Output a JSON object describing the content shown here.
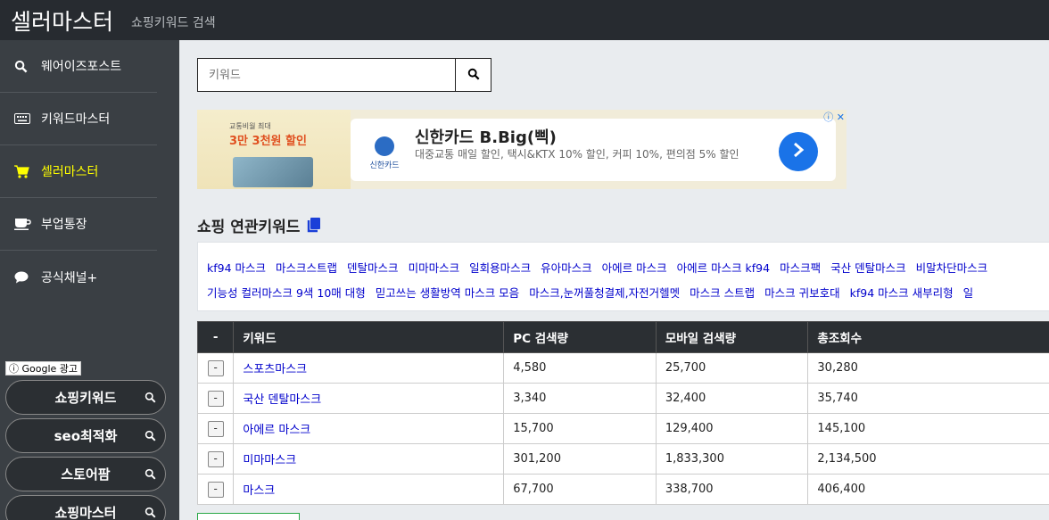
{
  "header": {
    "brand": "셀러마스터",
    "subtitle": "쇼핑키워드 검색"
  },
  "sidebar": {
    "items": [
      {
        "label": "웨어이즈포스트",
        "icon": "search-icon",
        "active": false
      },
      {
        "label": "키워드마스터",
        "icon": "keyboard-icon",
        "active": false
      },
      {
        "label": "셀러마스터",
        "icon": "shopping-cart-icon",
        "active": true
      },
      {
        "label": "부업통장",
        "icon": "coffee-cup-icon",
        "active": false
      },
      {
        "label": "공식채널+",
        "icon": "chat-bubble-icon",
        "active": false
      }
    ],
    "ad_label": "Google 광고",
    "ad_pills": [
      "쇼핑키워드",
      "seo최적화",
      "스토어팜",
      "쇼핑마스터"
    ]
  },
  "search": {
    "placeholder": "키워드",
    "value": ""
  },
  "ad": {
    "promo_small": "교통비월 최대",
    "promo_main": "3만 3천원 할인",
    "logo_text": "신한카드",
    "title": "신한카드 B.Big(삑)",
    "description": "대중교통 매일 할인, 택시&KTX 10% 할인, 커피 10%, 편의점 5% 할인"
  },
  "related": {
    "title": "쇼핑 연관키워드",
    "line1": [
      "kf94 마스크",
      "마스크스트랩",
      "덴탈마스크",
      "미마마스크",
      "일회용마스크",
      "유아마스크",
      "아에르 마스크",
      "아에르 마스크 kf94",
      "마스크팩",
      "국산 덴탈마스크",
      "비말차단마스크"
    ],
    "line2": [
      "기능성 컬러마스크 9색 10매 대형",
      "믿고쓰는 생활방역 마스크 모음",
      "마스크,눈꺼풀청결제,자전거헬멧",
      "마스크 스트랩",
      "마스크 귀보호대",
      "kf94 마스크 새부리형",
      "일"
    ]
  },
  "table": {
    "headers": [
      "-",
      "키워드",
      "PC 검색량",
      "모바일 검색량",
      "총조회수"
    ],
    "rows": [
      {
        "btn": "-",
        "keyword": "스포츠마스크",
        "pc": "4,580",
        "mobile": "25,700",
        "total": "30,280"
      },
      {
        "btn": "-",
        "keyword": "국산 덴탈마스크",
        "pc": "3,340",
        "mobile": "32,400",
        "total": "35,740"
      },
      {
        "btn": "-",
        "keyword": "아에르 마스크",
        "pc": "15,700",
        "mobile": "129,400",
        "total": "145,100"
      },
      {
        "btn": "-",
        "keyword": "미마마스크",
        "pc": "301,200",
        "mobile": "1,833,300",
        "total": "2,134,500"
      },
      {
        "btn": "-",
        "keyword": "마스크",
        "pc": "67,700",
        "mobile": "338,700",
        "total": "406,400"
      }
    ]
  },
  "colors": {
    "topbar": "#272b30",
    "sidebar": "#3a3f44",
    "active": "#ffff00",
    "link": "#0000cc"
  }
}
